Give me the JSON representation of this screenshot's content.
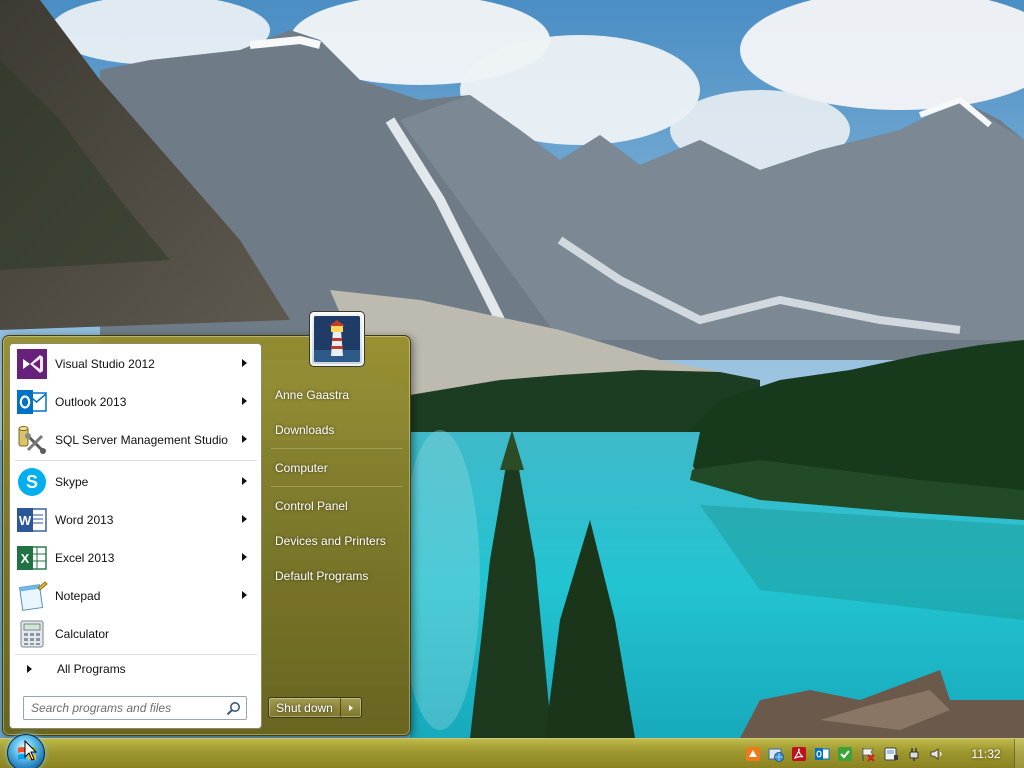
{
  "start_menu": {
    "pinned_programs": [
      {
        "label": "Visual Studio 2012",
        "icon": "visual-studio-icon"
      },
      {
        "label": "Outlook 2013",
        "icon": "outlook-icon"
      },
      {
        "label": "SQL Server Management Studio",
        "icon": "sql-server-icon"
      }
    ],
    "recent_programs": [
      {
        "label": "Skype",
        "icon": "skype-icon"
      },
      {
        "label": "Word 2013",
        "icon": "word-icon"
      },
      {
        "label": "Excel 2013",
        "icon": "excel-icon"
      },
      {
        "label": "Notepad",
        "icon": "notepad-icon"
      },
      {
        "label": "Calculator",
        "icon": "calculator-icon"
      }
    ],
    "all_programs_label": "All Programs",
    "search_placeholder": "Search programs and files",
    "right_pane": [
      "Anne Gaastra",
      "Downloads",
      "Computer",
      "Control Panel",
      "Devices and Printers",
      "Default Programs"
    ],
    "shutdown_label": "Shut down"
  },
  "taskbar": {
    "clock": "11:32",
    "tray_icons": [
      "orange-app-icon",
      "network-globe-icon",
      "acrobat-icon",
      "outlook-tray-icon",
      "green-check-icon",
      "action-center-flag-icon",
      "device-icon",
      "power-plug-icon",
      "volume-icon"
    ]
  },
  "theme": {
    "glass_color": "#968c28",
    "accent": "#1f78b8"
  }
}
